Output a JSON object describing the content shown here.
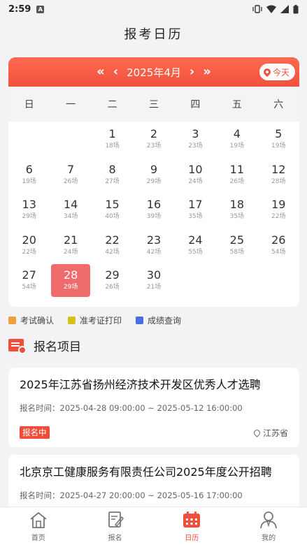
{
  "status": {
    "time": "2:59",
    "notif": "A"
  },
  "title": "报考日历",
  "calendar": {
    "month_label": "2025年4月",
    "today_label": "今天",
    "weekdays": [
      "日",
      "一",
      "二",
      "三",
      "四",
      "五",
      "六"
    ],
    "days": [
      {
        "n": "",
        "c": ""
      },
      {
        "n": "",
        "c": ""
      },
      {
        "n": "1",
        "c": "18场"
      },
      {
        "n": "2",
        "c": "23场"
      },
      {
        "n": "3",
        "c": "23场"
      },
      {
        "n": "4",
        "c": "19场"
      },
      {
        "n": "5",
        "c": "19场"
      },
      {
        "n": "6",
        "c": "19场"
      },
      {
        "n": "7",
        "c": "26场"
      },
      {
        "n": "8",
        "c": "27场"
      },
      {
        "n": "9",
        "c": "29场"
      },
      {
        "n": "10",
        "c": "24场"
      },
      {
        "n": "11",
        "c": "26场"
      },
      {
        "n": "12",
        "c": "28场"
      },
      {
        "n": "13",
        "c": "29场"
      },
      {
        "n": "14",
        "c": "34场"
      },
      {
        "n": "15",
        "c": "40场"
      },
      {
        "n": "16",
        "c": "39场"
      },
      {
        "n": "17",
        "c": "35场"
      },
      {
        "n": "18",
        "c": "35场"
      },
      {
        "n": "19",
        "c": "22场"
      },
      {
        "n": "20",
        "c": "22场"
      },
      {
        "n": "21",
        "c": "24场"
      },
      {
        "n": "22",
        "c": "42场"
      },
      {
        "n": "23",
        "c": "42场"
      },
      {
        "n": "24",
        "c": "55场"
      },
      {
        "n": "25",
        "c": "58场"
      },
      {
        "n": "26",
        "c": "54场"
      },
      {
        "n": "27",
        "c": "54场"
      },
      {
        "n": "28",
        "c": "29场",
        "selected": true
      },
      {
        "n": "29",
        "c": "26场"
      },
      {
        "n": "30",
        "c": "21场"
      }
    ]
  },
  "legend": [
    {
      "label": "考试确认",
      "color": "#f0a040"
    },
    {
      "label": "准考证打印",
      "color": "#d4c21a"
    },
    {
      "label": "成绩查询",
      "color": "#4a6ee0"
    }
  ],
  "section_title": "报名项目",
  "cards": [
    {
      "title": "2025年江苏省扬州经济技术开发区优秀人才选聘",
      "time": "报名时间：2025-04-28 09:00:00 ~ 2025-05-12 16:00:00",
      "badge": "报名中",
      "location": "江苏省"
    },
    {
      "title": "北京京工健康服务有限责任公司2025年度公开招聘",
      "time": "报名时间：2025-04-27 20:00:00 ~ 2025-05-16 17:00:00"
    }
  ],
  "tabs": [
    {
      "label": "首页",
      "icon": "home-icon"
    },
    {
      "label": "报名",
      "icon": "signup-icon"
    },
    {
      "label": "日历",
      "icon": "calendar-icon",
      "active": true
    },
    {
      "label": "我的",
      "icon": "profile-icon"
    }
  ],
  "colors": {
    "accent": "#ef4f3b",
    "selected_day": "#f06b6b"
  }
}
